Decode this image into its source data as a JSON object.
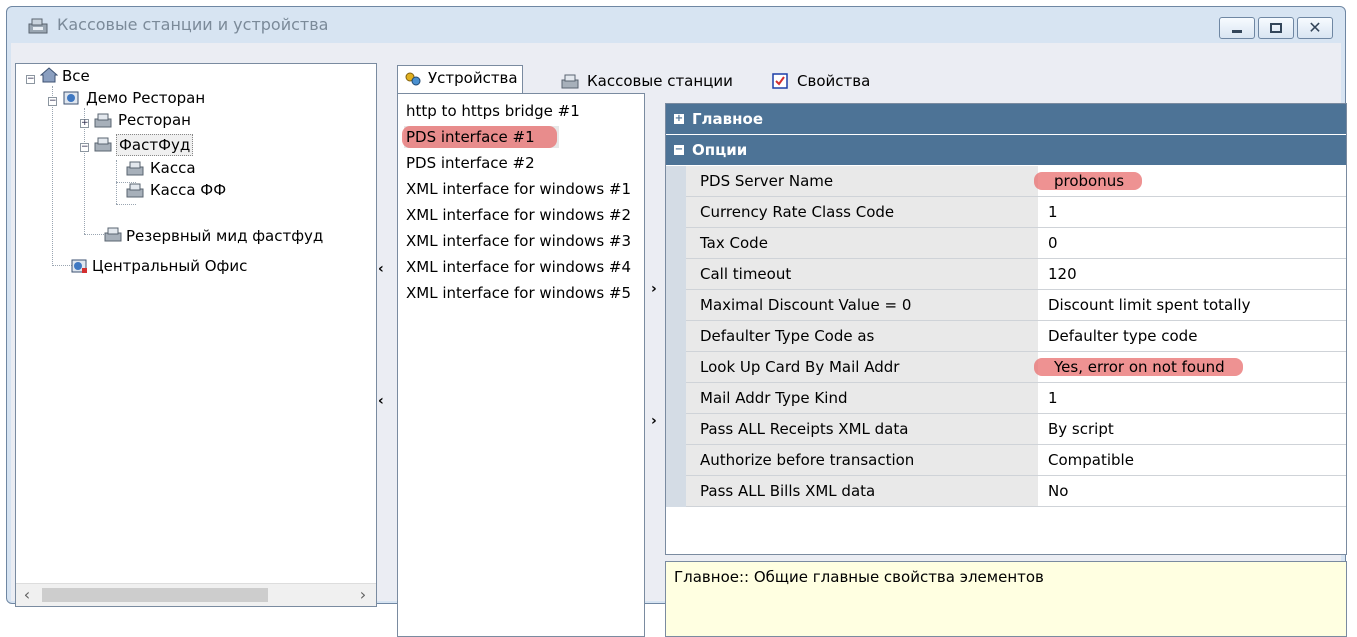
{
  "window": {
    "title": "Кассовые станции и устройства",
    "controls": [
      "minimize",
      "maximize",
      "close"
    ]
  },
  "tree": {
    "nodes": [
      {
        "label": "Все",
        "icon": "house-icon",
        "level": 0
      },
      {
        "label": "Демо Ресторан",
        "icon": "globe-icon",
        "level": 1
      },
      {
        "label": "Ресторан",
        "icon": "cash-register-icon",
        "level": 2
      },
      {
        "label": "ФастФуд",
        "icon": "cash-register-icon",
        "level": 2,
        "selected": true
      },
      {
        "label": "Касса",
        "icon": "cash-register-icon",
        "level": 3
      },
      {
        "label": "Касса ФФ",
        "icon": "cash-register-icon",
        "level": 3
      },
      {
        "label": "Резервный мид фастфуд",
        "icon": "cash-register-icon",
        "level": 2
      },
      {
        "label": "Центральный Офис",
        "icon": "office-icon",
        "level": 1
      }
    ]
  },
  "tabs": [
    {
      "label": "Устройства",
      "icon": "devices-icon",
      "active": true
    },
    {
      "label": "Кассовые станции",
      "icon": "cash-register-icon",
      "active": false
    },
    {
      "label": "Свойства",
      "icon": "checklist-icon",
      "active": false
    }
  ],
  "devices": [
    {
      "label": "http to https bridge #1"
    },
    {
      "label": "PDS interface #1",
      "selected": true
    },
    {
      "label": "PDS interface #2"
    },
    {
      "label": "XML interface for windows #1"
    },
    {
      "label": "XML interface for windows #2"
    },
    {
      "label": "XML interface for windows #3"
    },
    {
      "label": "XML interface for windows #4"
    },
    {
      "label": "XML interface for windows #5"
    }
  ],
  "property_grid": {
    "categories": [
      {
        "label": "Главное",
        "expanded": false
      },
      {
        "label": "Опции",
        "expanded": true
      }
    ],
    "rows": [
      {
        "name": "PDS Server Name",
        "value": "probonus",
        "highlighted": true
      },
      {
        "name": "Currency Rate Class Code",
        "value": "1"
      },
      {
        "name": "Tax Code",
        "value": "0"
      },
      {
        "name": "Call timeout",
        "value": "120"
      },
      {
        "name": "Maximal Discount Value = 0",
        "value": "Discount limit spent totally"
      },
      {
        "name": "Defaulter Type Code as",
        "value": "Defaulter type code"
      },
      {
        "name": "Look Up Card By Mail Addr",
        "value": "Yes, error on not found",
        "highlighted": true
      },
      {
        "name": "Mail Addr Type Kind",
        "value": "1"
      },
      {
        "name": "Pass ALL Receipts XML data",
        "value": "By script"
      },
      {
        "name": "Authorize before transaction",
        "value": "Compatible"
      },
      {
        "name": "Pass ALL Bills XML data",
        "value": "No"
      }
    ]
  },
  "description": "Главное:: Общие главные свойства элементов",
  "colors": {
    "window_frame": "#d7e4f2",
    "category_header": "#4d7396",
    "highlight": "#e86e6e",
    "description_bg": "#ffffe1"
  }
}
